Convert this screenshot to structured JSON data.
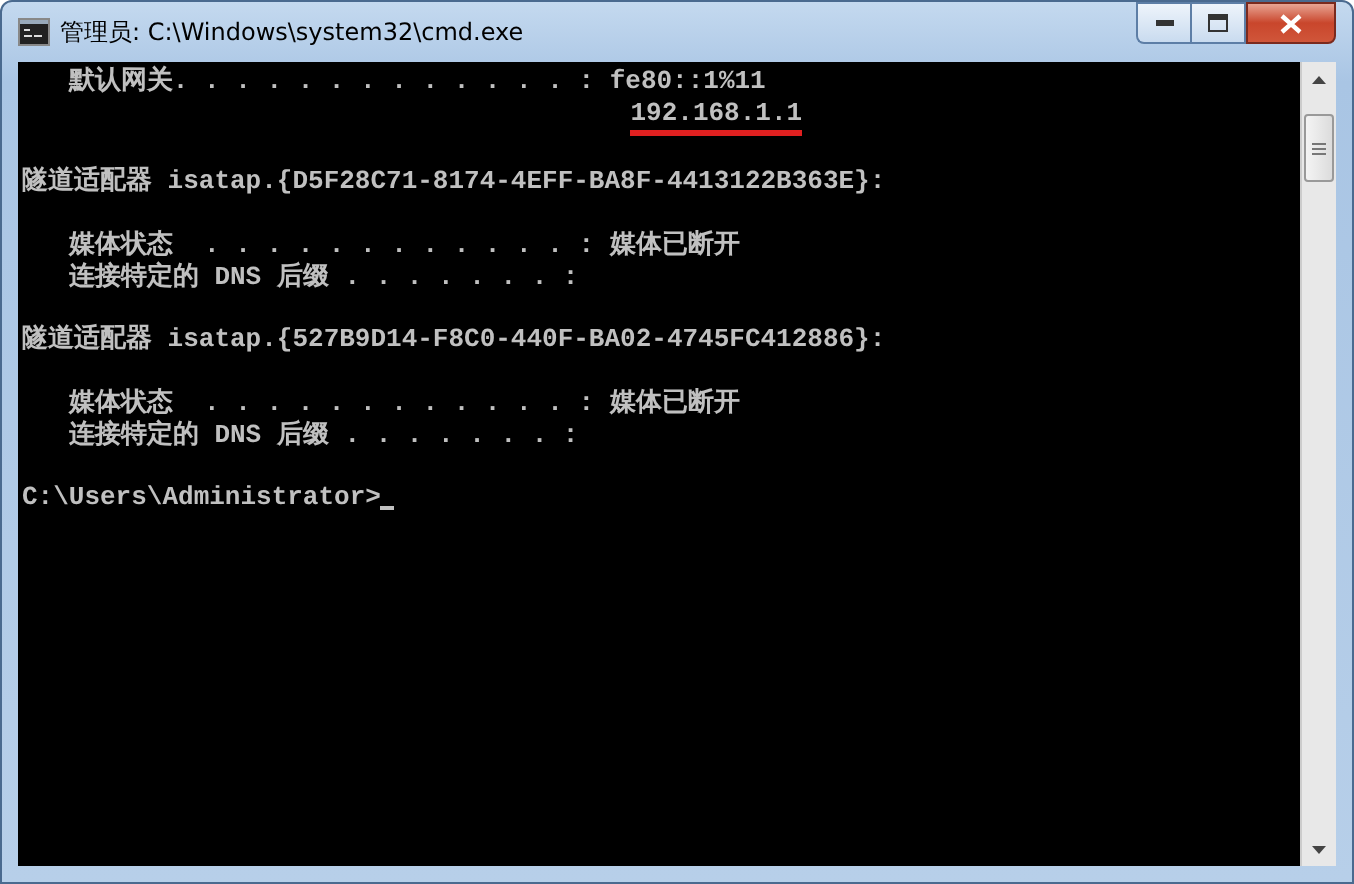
{
  "window": {
    "title": "管理员: C:\\Windows\\system32\\cmd.exe"
  },
  "console": {
    "lines": [
      {
        "kind": "text",
        "text": "   默认网关. . . . . . . . . . . . . : fe80::1%11",
        "underlined": false
      },
      {
        "kind": "text",
        "text": "                                       192.168.1.1",
        "underlined": true
      },
      {
        "kind": "blank"
      },
      {
        "kind": "text",
        "text": "隧道适配器 isatap.{D5F28C71-8174-4EFF-BA8F-4413122B363E}:",
        "underlined": false
      },
      {
        "kind": "blank"
      },
      {
        "kind": "text",
        "text": "   媒体状态  . . . . . . . . . . . . : 媒体已断开",
        "underlined": false
      },
      {
        "kind": "text",
        "text": "   连接特定的 DNS 后缀 . . . . . . . :",
        "underlined": false
      },
      {
        "kind": "blank"
      },
      {
        "kind": "text",
        "text": "隧道适配器 isatap.{527B9D14-F8C0-440F-BA02-4745FC412886}:",
        "underlined": false
      },
      {
        "kind": "blank"
      },
      {
        "kind": "text",
        "text": "   媒体状态  . . . . . . . . . . . . : 媒体已断开",
        "underlined": false
      },
      {
        "kind": "text",
        "text": "   连接特定的 DNS 后缀 . . . . . . . :",
        "underlined": false
      },
      {
        "kind": "blank"
      },
      {
        "kind": "prompt",
        "text": "C:\\Users\\Administrator>"
      }
    ]
  }
}
